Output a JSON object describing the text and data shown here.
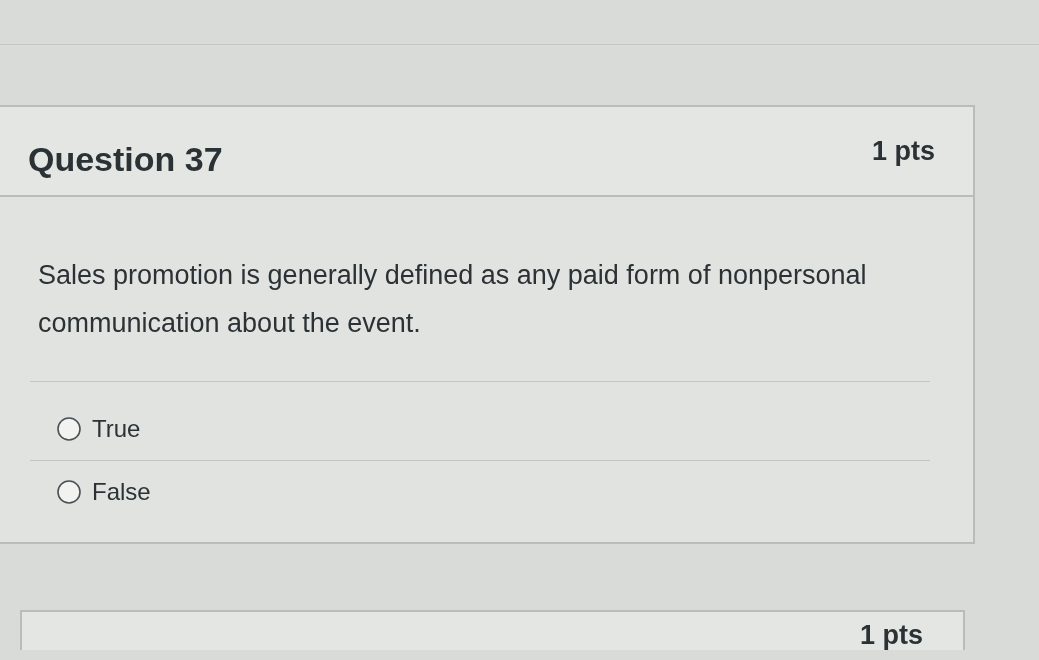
{
  "questions": [
    {
      "title": "Question 37",
      "points": "1 pts",
      "text": "Sales promotion is generally defined as any paid form of nonpersonal communication about the event.",
      "answers": [
        {
          "label": "True",
          "selected": false
        },
        {
          "label": "False",
          "selected": false
        }
      ]
    },
    {
      "points": "1 pts"
    }
  ]
}
